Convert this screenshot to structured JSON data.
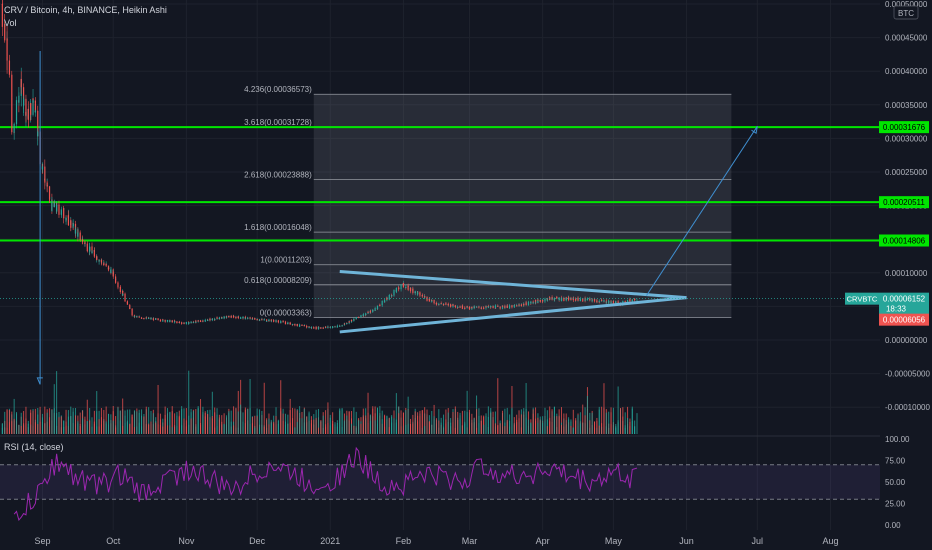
{
  "header": {
    "symbol_line": "CRV / Bitcoin, 4h, BINANCE, Heikin Ashi",
    "vol_label": "Vol",
    "rsi_label": "RSI (14, close)",
    "currency": "BTC"
  },
  "chart_data": [
    {
      "type": "candlestick",
      "title": "CRV / Bitcoin, 4h, BINANCE, Heikin Ashi",
      "x_ticks": [
        "Sep",
        "Oct",
        "Nov",
        "Dec",
        "2021",
        "Feb",
        "Mar",
        "Apr",
        "May",
        "Jun",
        "Jul",
        "Aug"
      ],
      "y_ticks": [
        "0.00050000",
        "0.00045000",
        "0.00040000",
        "0.00035000",
        "0.00030000",
        "0.00025000",
        "0.00020000",
        "0.00015000",
        "0.00010000",
        "0.00005000",
        "0.00000000",
        "-0.00005000",
        "-0.00010000"
      ],
      "ylim": [
        -0.000122,
        0.0005
      ],
      "x_range": [
        "2020-08-15",
        "2021-08-20"
      ],
      "price_path": [
        {
          "x": "2020-08-15",
          "y": 0.0005
        },
        {
          "x": "2020-08-18",
          "y": 0.00042
        },
        {
          "x": "2020-08-20",
          "y": 0.0003
        },
        {
          "x": "2020-08-23",
          "y": 0.00038
        },
        {
          "x": "2020-08-26",
          "y": 0.00033
        },
        {
          "x": "2020-08-29",
          "y": 0.00036
        },
        {
          "x": "2020-09-01",
          "y": 0.00026
        },
        {
          "x": "2020-09-05",
          "y": 0.0002
        },
        {
          "x": "2020-09-10",
          "y": 0.00019
        },
        {
          "x": "2020-09-20",
          "y": 0.00014
        },
        {
          "x": "2020-10-01",
          "y": 0.0001
        },
        {
          "x": "2020-10-10",
          "y": 3.5e-05
        },
        {
          "x": "2020-11-01",
          "y": 2.5e-05
        },
        {
          "x": "2020-11-20",
          "y": 3.5e-05
        },
        {
          "x": "2020-12-10",
          "y": 2.8e-05
        },
        {
          "x": "2020-12-25",
          "y": 1.8e-05
        },
        {
          "x": "2021-01-05",
          "y": 2e-05
        },
        {
          "x": "2021-01-20",
          "y": 4.5e-05
        },
        {
          "x": "2021-02-01",
          "y": 8.2e-05
        },
        {
          "x": "2021-02-15",
          "y": 5.5e-05
        },
        {
          "x": "2021-03-01",
          "y": 4.8e-05
        },
        {
          "x": "2021-03-20",
          "y": 5e-05
        },
        {
          "x": "2021-04-05",
          "y": 6.2e-05
        },
        {
          "x": "2021-04-20",
          "y": 6e-05
        },
        {
          "x": "2021-05-05",
          "y": 5.5e-05
        },
        {
          "x": "2021-05-11",
          "y": 6.152e-05
        }
      ],
      "last_price": "0.00006152",
      "countdown": "18:33",
      "symbol_tag": "CRVBTC",
      "previous_close": "0.00006056",
      "horizontal_levels": [
        {
          "value": 0.00031676,
          "label": "0.00031676",
          "color": "#00e600"
        },
        {
          "value": 0.00020511,
          "label": "0.00020511",
          "color": "#00e600"
        },
        {
          "value": 0.00014806,
          "label": "0.00014806",
          "color": "#00e600"
        }
      ],
      "fib_extension": {
        "start": "2020-12-25",
        "end": "2021-06-20",
        "levels": [
          {
            "ratio": 4.236,
            "value": 0.00036573,
            "label": "4.236(0.00036573)"
          },
          {
            "ratio": 3.618,
            "value": 0.00031728,
            "label": "3.618(0.00031728)"
          },
          {
            "ratio": 2.618,
            "value": 0.00023888,
            "label": "2.618(0.00023888)"
          },
          {
            "ratio": 1.618,
            "value": 0.00016048,
            "label": "1.618(0.00016048)"
          },
          {
            "ratio": 1,
            "value": 0.00011203,
            "label": "1(0.00011203)"
          },
          {
            "ratio": 0.618,
            "value": 8.209e-05,
            "label": "0.618(0.00008209)"
          },
          {
            "ratio": 0,
            "value": 3.363e-05,
            "label": "0(0.00003363)"
          }
        ]
      },
      "triangle": {
        "upper": [
          {
            "x": "2021-01-05",
            "y": 0.000102
          },
          {
            "x": "2021-06-01",
            "y": 6.3e-05
          }
        ],
        "lower": [
          {
            "x": "2021-01-05",
            "y": 1.2e-05
          },
          {
            "x": "2021-06-01",
            "y": 6.3e-05
          }
        ]
      },
      "projection_arrow": [
        {
          "x": "2021-05-15",
          "y": 6.6e-05
        },
        {
          "x": "2021-07-01",
          "y": 0.000318
        }
      ],
      "drop_arrow": [
        {
          "x": "2020-08-31",
          "y": 0.00043
        },
        {
          "x": "2020-08-31",
          "y": -6.6e-05
        }
      ]
    },
    {
      "type": "bar",
      "title": "Vol",
      "description": "volume bars, green/red by candle direction",
      "x_range": [
        "2020-08-15",
        "2021-05-11"
      ]
    },
    {
      "type": "line",
      "title": "RSI (14, close)",
      "y_ticks": [
        "100.00",
        "75.00",
        "50.00",
        "25.00",
        "0.00"
      ],
      "ylim": [
        0,
        100
      ],
      "bands": [
        70,
        30
      ],
      "color": "#9c27b0",
      "x_range": [
        "2020-08-20",
        "2021-05-11"
      ],
      "approx_values": [
        10,
        30,
        75,
        55,
        45,
        60,
        35,
        50,
        65,
        55,
        40,
        55,
        70,
        60,
        45,
        55,
        80,
        50,
        45,
        60,
        55,
        50,
        70,
        55,
        60,
        65,
        55,
        50,
        60,
        55
      ]
    }
  ],
  "colors": {
    "background": "#131722",
    "up": "#26a69a",
    "down": "#ef5350",
    "level_green": "#00e600",
    "trend_blue": "#6fb4d8",
    "rsi_purple": "#9c27b0"
  }
}
